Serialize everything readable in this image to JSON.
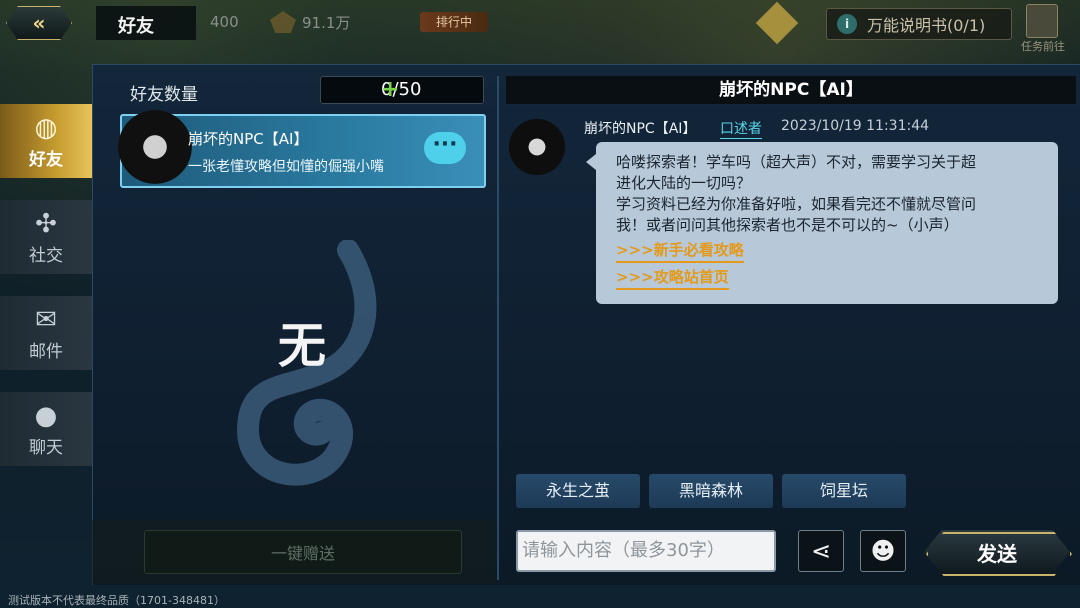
{
  "header": {
    "title": "好友",
    "resource1": "400",
    "resource2": "91.1万",
    "rank_label": "排行中",
    "guide_label": "万能说明书(0/1)",
    "tasks_label": "任务前往"
  },
  "nav": {
    "items": [
      {
        "label": "好友",
        "icon": "friend-icon",
        "active": true
      },
      {
        "label": "社交",
        "icon": "social-icon",
        "active": false
      },
      {
        "label": "邮件",
        "icon": "mail-icon",
        "active": false
      },
      {
        "label": "聊天",
        "icon": "chat-icon",
        "active": false
      }
    ]
  },
  "friends": {
    "count_label": "好友数量",
    "count_value": "0/50",
    "card": {
      "name": "崩坏的NPC【AI】",
      "signature": "一张老懂攻略但如懂的倔强小嘴"
    },
    "empty_text": "无",
    "gift_all_label": "一键赠送"
  },
  "chat": {
    "title": "崩坏的NPC【AI】",
    "message": {
      "sender": "崩坏的NPC【AI】",
      "role": "口述者",
      "time": "2023/10/19 11:31:44",
      "line1": "哈喽探索者！学车吗（超大声）不对，需要学习关于超",
      "line2": "进化大陆的一切吗？",
      "line3": "学习资料已经为你准备好啦，如果看完还不懂就尽管问",
      "line4": "我！或者问问其他探索者也不是不可以的~（小声）",
      "link1": ">>>新手必看攻略",
      "link2": ">>>攻略站首页"
    },
    "quick_replies": [
      "永生之茧",
      "黑暗森林",
      "饲星坛"
    ],
    "input_placeholder": "请输入内容（最多30字）",
    "send_label": "发送"
  },
  "footer": {
    "note": "测试版本不代表最终品质（1701-348481）"
  }
}
